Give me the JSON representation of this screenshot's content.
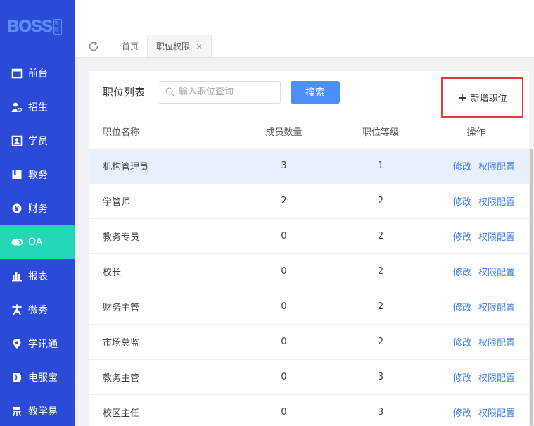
{
  "logo": {
    "text": "BOSS",
    "badge": "旗舰"
  },
  "sidebar": {
    "items": [
      {
        "label": "前台",
        "icon": "calendar-icon"
      },
      {
        "label": "招生",
        "icon": "user-add-icon"
      },
      {
        "label": "学员",
        "icon": "student-card-icon"
      },
      {
        "label": "教务",
        "icon": "book-icon"
      },
      {
        "label": "财务",
        "icon": "yen-coin-icon"
      },
      {
        "label": "OA",
        "icon": "chat-bubbles-icon",
        "active": true
      },
      {
        "label": "报表",
        "icon": "bar-chart-icon"
      },
      {
        "label": "微秀",
        "icon": "wei-xiu-icon"
      },
      {
        "label": "学讯通",
        "icon": "location-pin-icon"
      },
      {
        "label": "电服宝",
        "icon": "phone-service-icon"
      },
      {
        "label": "教学易",
        "icon": "teach-icon"
      }
    ]
  },
  "tabs": [
    {
      "label": "首页"
    },
    {
      "label": "职位权限",
      "close": "×"
    }
  ],
  "card": {
    "title": "职位列表",
    "search_placeholder": "输入职位查询",
    "search_button": "搜索",
    "add_button": "新增职位",
    "add_icon": "+"
  },
  "table": {
    "headers": [
      "职位名称",
      "成员数量",
      "职位等级",
      "操作"
    ],
    "rows": [
      {
        "name": "机构管理员",
        "members": "3",
        "level": "1",
        "edit": "修改",
        "perm": "权限配置"
      },
      {
        "name": "学管师",
        "members": "2",
        "level": "2",
        "edit": "修改",
        "perm": "权限配置"
      },
      {
        "name": "教务专员",
        "members": "0",
        "level": "2",
        "edit": "修改",
        "perm": "权限配置"
      },
      {
        "name": "校长",
        "members": "0",
        "level": "2",
        "edit": "修改",
        "perm": "权限配置"
      },
      {
        "name": "财务主管",
        "members": "0",
        "level": "2",
        "edit": "修改",
        "perm": "权限配置"
      },
      {
        "name": "市场总监",
        "members": "0",
        "level": "2",
        "edit": "修改",
        "perm": "权限配置"
      },
      {
        "name": "教务主管",
        "members": "0",
        "level": "3",
        "edit": "修改",
        "perm": "权限配置"
      },
      {
        "name": "校区主任",
        "members": "0",
        "level": "3",
        "edit": "修改",
        "perm": "权限配置"
      }
    ]
  },
  "colors": {
    "sidebar": "#2b4bd6",
    "active": "#23d7b7",
    "primary": "#4b8ff8",
    "link": "#3f7ff0",
    "highlight_border": "#e23a3a"
  }
}
